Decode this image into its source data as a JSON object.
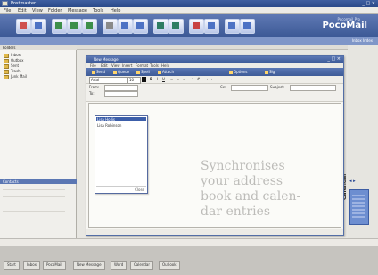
{
  "app": {
    "title": "Postmaster",
    "window_controls": "_ □ ×",
    "brand": "PocoMail",
    "brand_sub": "Pocomail Pro"
  },
  "menubar": {
    "items": [
      "File",
      "Edit",
      "View",
      "Folder",
      "Message",
      "Tools",
      "Help"
    ]
  },
  "viewbar": {
    "label": "Inbox Index"
  },
  "folders": {
    "header": "Folders",
    "items": [
      "Inbox",
      "Outbox",
      "Sent",
      "Trash",
      "Junk Mail"
    ]
  },
  "lower_left": {
    "header": "Contacts"
  },
  "compose": {
    "title": "New Message",
    "window_controls": "_ □ ×",
    "menu": [
      "File",
      "Edit",
      "View",
      "Insert",
      "Format",
      "Tools",
      "Help"
    ],
    "toolbar": [
      "Send",
      "Queue",
      "Spell",
      "Attach",
      "Options",
      "Sig"
    ],
    "font_name": "Arial",
    "font_size": "10",
    "fields": {
      "from_label": "From:",
      "to_label": "To:",
      "cc_label": "Cc:",
      "subject_label": "Subject:"
    }
  },
  "popup": {
    "selected": "Lisa Hollis",
    "items": [
      "Lisa Robinson"
    ],
    "footer": "Close"
  },
  "caption": {
    "lines": [
      "Synchronises",
      "your address",
      "book and calen-",
      "dar entries"
    ]
  },
  "taskbar": {
    "items": [
      "Start",
      "Inbox",
      "PocoMail",
      "New Message",
      "Word",
      "Calendar",
      "Outlook"
    ]
  },
  "right_panel": {
    "label": "Calendar"
  }
}
